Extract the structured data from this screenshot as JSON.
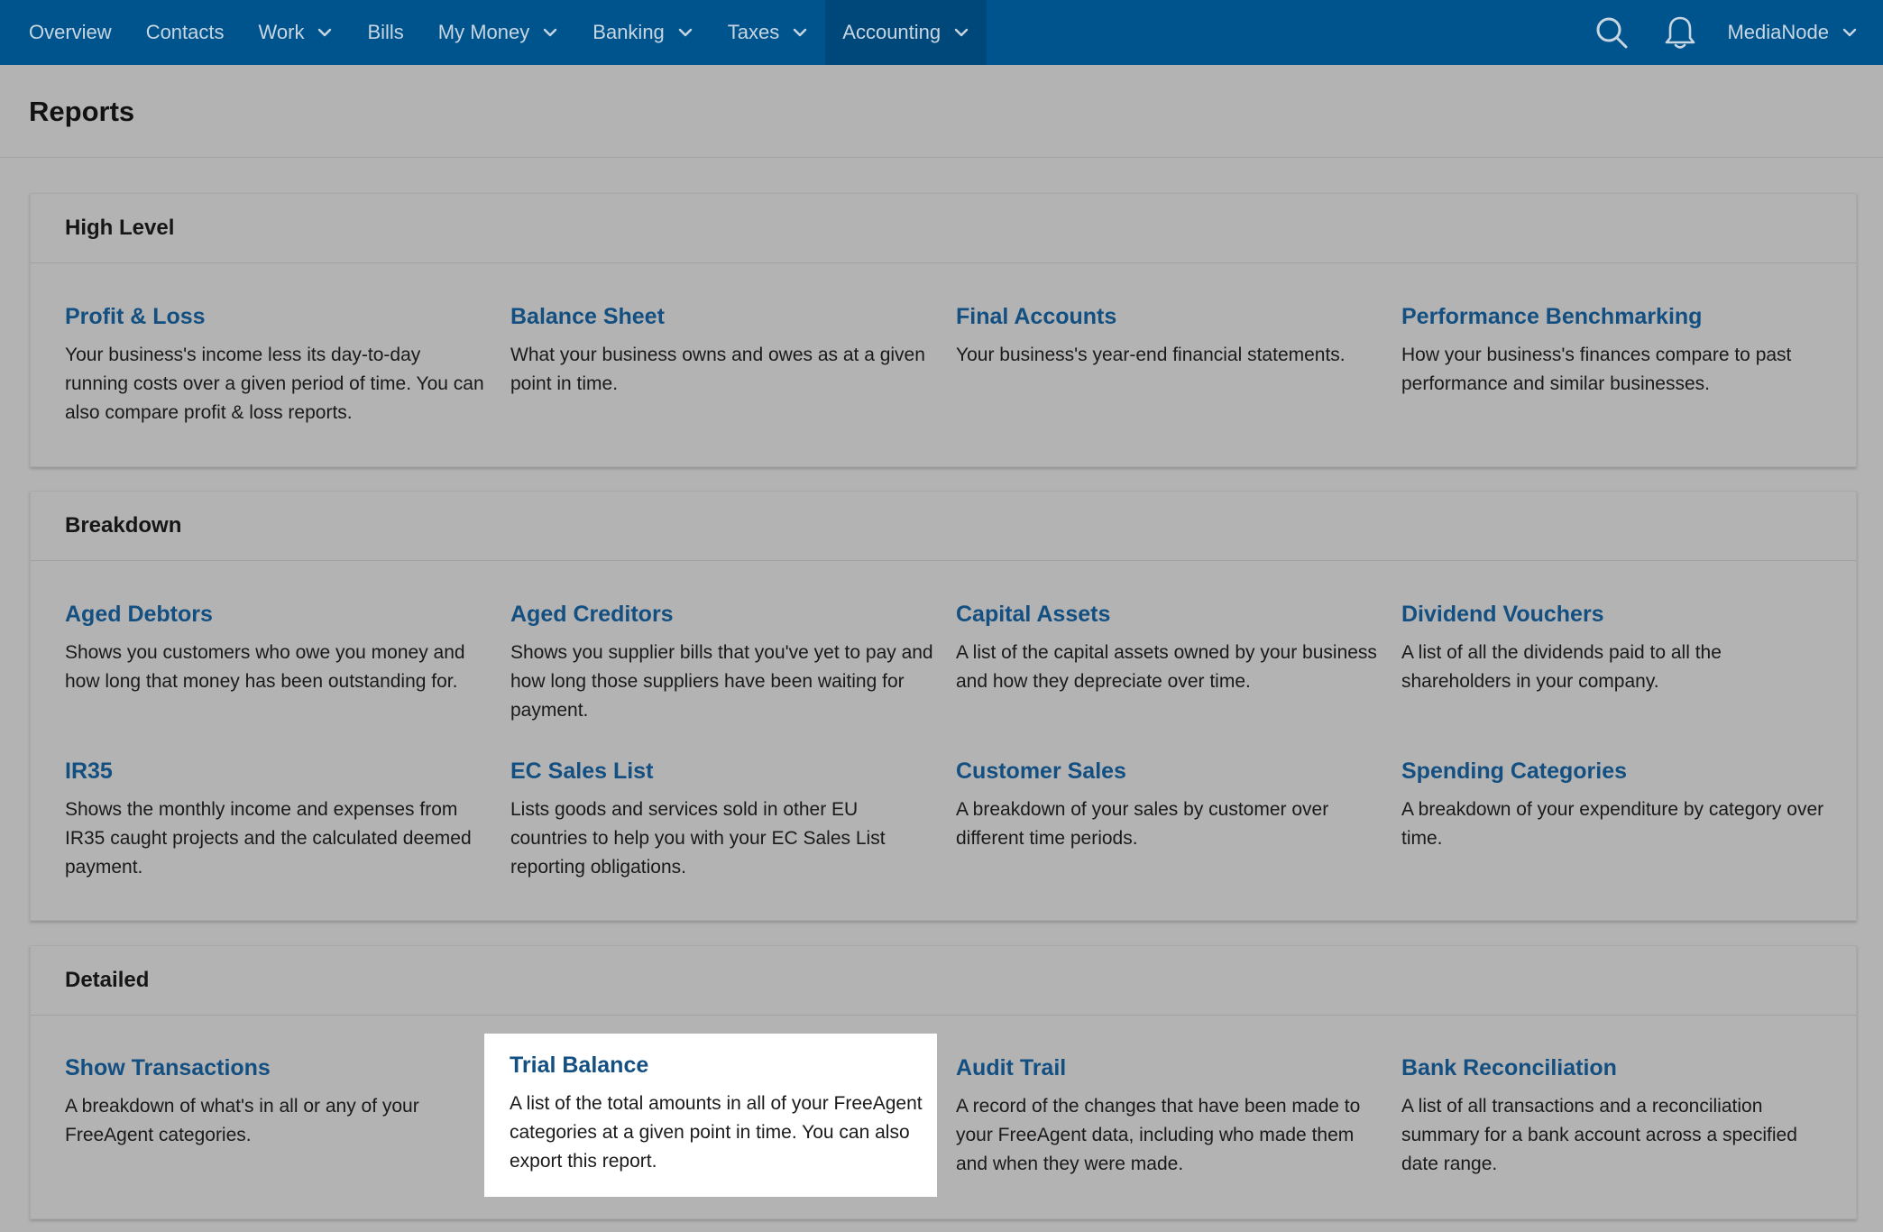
{
  "nav": {
    "items": [
      {
        "label": "Overview",
        "dropdown": false,
        "active": false
      },
      {
        "label": "Contacts",
        "dropdown": false,
        "active": false
      },
      {
        "label": "Work",
        "dropdown": true,
        "active": false
      },
      {
        "label": "Bills",
        "dropdown": false,
        "active": false
      },
      {
        "label": "My Money",
        "dropdown": true,
        "active": false
      },
      {
        "label": "Banking",
        "dropdown": true,
        "active": false
      },
      {
        "label": "Taxes",
        "dropdown": true,
        "active": false
      },
      {
        "label": "Accounting",
        "dropdown": true,
        "active": true
      }
    ],
    "user_label": "MediaNode",
    "icons": [
      "search-icon",
      "bell-icon",
      "chevron-down-icon"
    ]
  },
  "page": {
    "title": "Reports"
  },
  "sections": [
    {
      "title": "High Level",
      "reports": [
        {
          "title": "Profit & Loss",
          "desc": "Your business's income less its day-to-day running costs over a given period of time. You can also compare profit & loss reports."
        },
        {
          "title": "Balance Sheet",
          "desc": "What your business owns and owes as at a given point in time."
        },
        {
          "title": "Final Accounts",
          "desc": "Your business's year-end financial statements."
        },
        {
          "title": "Performance Benchmarking",
          "desc": "How your business's finances compare to past performance and similar businesses."
        }
      ]
    },
    {
      "title": "Breakdown",
      "reports": [
        {
          "title": "Aged Debtors",
          "desc": "Shows you customers who owe you money and how long that money has been outstanding for."
        },
        {
          "title": "Aged Creditors",
          "desc": "Shows you supplier bills that you've yet to pay and how long those suppliers have been waiting for payment."
        },
        {
          "title": "Capital Assets",
          "desc": "A list of the capital assets owned by your business and how they depreciate over time."
        },
        {
          "title": "Dividend Vouchers",
          "desc": "A list of all the dividends paid to all the shareholders in your company."
        },
        {
          "title": "IR35",
          "desc": "Shows the monthly income and expenses from IR35 caught projects and the calculated deemed payment."
        },
        {
          "title": "EC Sales List",
          "desc": "Lists goods and services sold in other EU countries to help you with your EC Sales List reporting obligations."
        },
        {
          "title": "Customer Sales",
          "desc": "A breakdown of your sales by customer over different time periods."
        },
        {
          "title": "Spending Categories",
          "desc": "A breakdown of your expenditure by category over time."
        }
      ]
    },
    {
      "title": "Detailed",
      "reports": [
        {
          "title": "Show Transactions",
          "desc": "A breakdown of what's in all or any of your FreeAgent categories."
        },
        {
          "title": "Trial Balance",
          "desc": "A list of the total amounts in all of your FreeAgent categories at a given point in time. You can also export this report.",
          "highlighted": true
        },
        {
          "title": "Audit Trail",
          "desc": "A record of the changes that have been made to your FreeAgent data, including who made them and when they were made."
        },
        {
          "title": "Bank Reconciliation",
          "desc": "A list of all transactions and a reconciliation summary for a bank account across a specified date range."
        }
      ]
    }
  ],
  "colors": {
    "nav_bg": "#00548d",
    "nav_active_bg": "#00477a",
    "link": "#134f81",
    "overlay": "#b3b3b3",
    "highlight": "#ffffff"
  }
}
